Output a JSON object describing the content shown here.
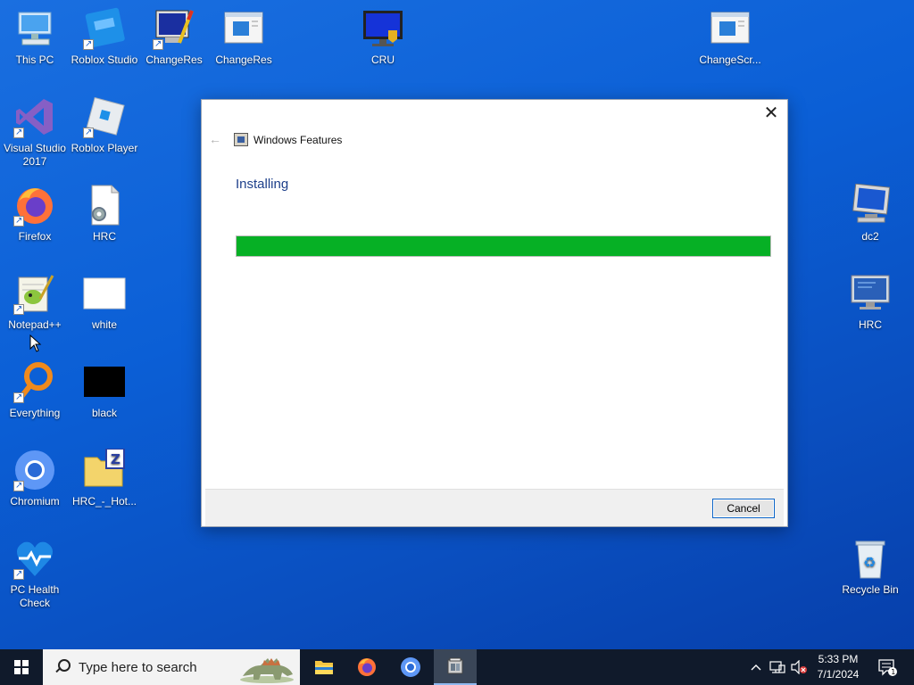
{
  "desktop": {
    "icons": [
      {
        "label": "This PC",
        "icon": "this-pc-icon"
      },
      {
        "label": "Roblox Studio",
        "icon": "roblox-studio-icon"
      },
      {
        "label": "ChangeRes",
        "icon": "changeres-app-icon"
      },
      {
        "label": "ChangeRes",
        "icon": "changeres-window-icon"
      },
      {
        "label": "CRU",
        "icon": "cru-monitor-icon"
      },
      {
        "label": "ChangeScr...",
        "icon": "changescreen-icon"
      },
      {
        "label": "Visual Studio 2017",
        "icon": "visual-studio-icon"
      },
      {
        "label": "Roblox Player",
        "icon": "roblox-player-icon"
      },
      {
        "label": "Firefox",
        "icon": "firefox-icon"
      },
      {
        "label": "HRC",
        "icon": "hrc-file-icon"
      },
      {
        "label": "Notepad++",
        "icon": "notepadpp-icon"
      },
      {
        "label": "white",
        "icon": "white-image-icon"
      },
      {
        "label": "Everything",
        "icon": "everything-search-icon"
      },
      {
        "label": "black",
        "icon": "black-image-icon"
      },
      {
        "label": "Chromium",
        "icon": "chromium-icon"
      },
      {
        "label": "HRC_-_Hot...",
        "icon": "zip-folder-icon"
      },
      {
        "label": "PC Health Check",
        "icon": "pc-health-icon"
      },
      {
        "label": "dc2",
        "icon": "remote-desktop-icon"
      },
      {
        "label": "HRC",
        "icon": "hrc-monitor-icon"
      },
      {
        "label": "Recycle Bin",
        "icon": "recycle-bin-icon"
      }
    ]
  },
  "dialog": {
    "title": "Windows Features",
    "status": "Installing",
    "progress": 1.0,
    "progress_color": "#06b025",
    "cancel_label": "Cancel",
    "close_glyph": "✕",
    "back_glyph": "←"
  },
  "taskbar": {
    "search_placeholder": "Type here to search",
    "apps": [
      "file-explorer-icon",
      "firefox-icon",
      "chromium-icon",
      "windows-features-icon"
    ],
    "time": "5:33 PM",
    "date": "7/1/2024",
    "notification_count": "1"
  }
}
